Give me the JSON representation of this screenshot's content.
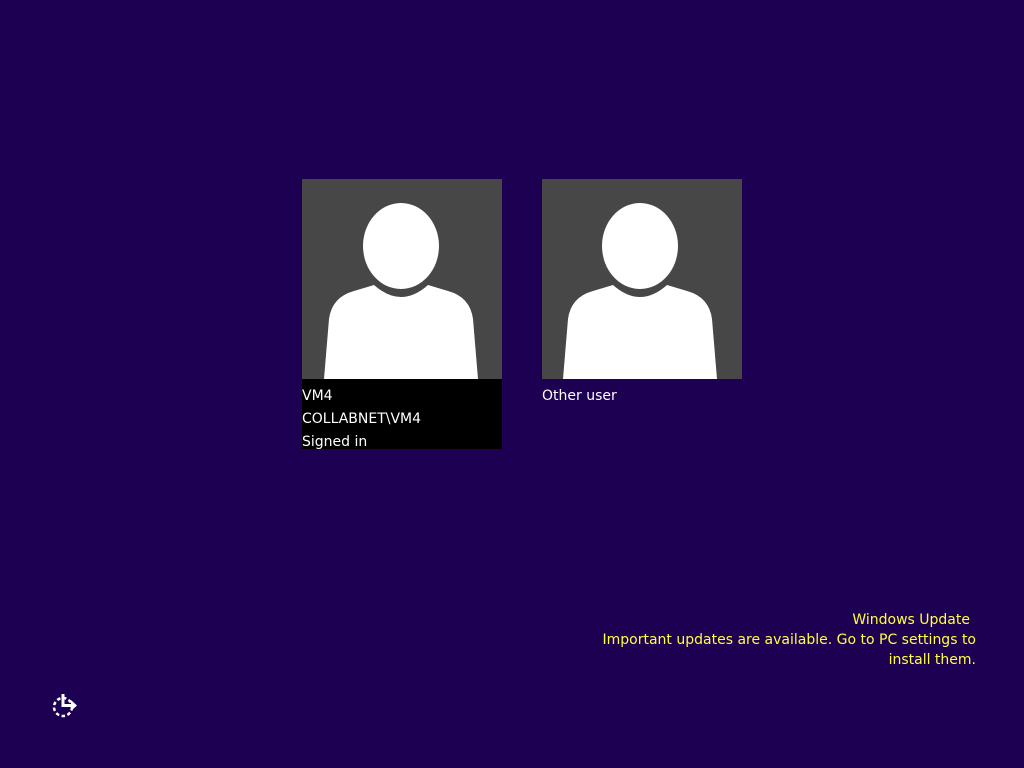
{
  "users": [
    {
      "name": "VM4",
      "account": "COLLABNET\\VM4",
      "status": "Signed in",
      "avatar_icon": "user-silhouette-icon",
      "selected": true
    },
    {
      "name": "Other user",
      "avatar_icon": "user-silhouette-icon",
      "selected": false
    }
  ],
  "windows_update": {
    "title": "Windows Update",
    "message": "Important updates are available. Go to PC settings to install them."
  },
  "ease_of_access": {
    "icon": "ease-of-access-icon"
  },
  "colors": {
    "background": "#1e0052",
    "tile": "#474747",
    "selected_info": "#000000",
    "notice_text": "#ffff40"
  }
}
